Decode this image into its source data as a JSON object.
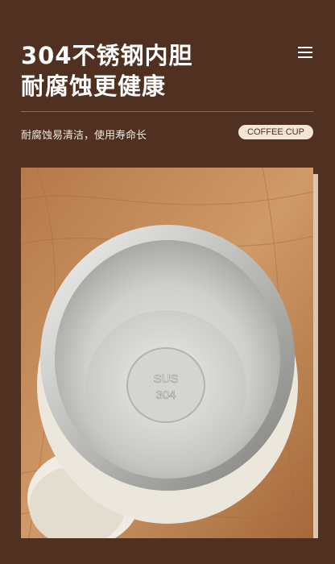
{
  "header": {
    "title_line1": "304不锈钢内胆",
    "title_line2": "耐腐蚀更健康",
    "menu_icon": "menu-icon"
  },
  "subtitle": "耐腐蚀易清洁，使用寿命长",
  "badge": "COFFEE CUP",
  "photo": {
    "engraving_line1": "SUS",
    "engraving_line2": "304"
  },
  "colors": {
    "background": "#4f3021",
    "badge_bg": "#f3e6d6",
    "wood": "#c98f5c"
  }
}
